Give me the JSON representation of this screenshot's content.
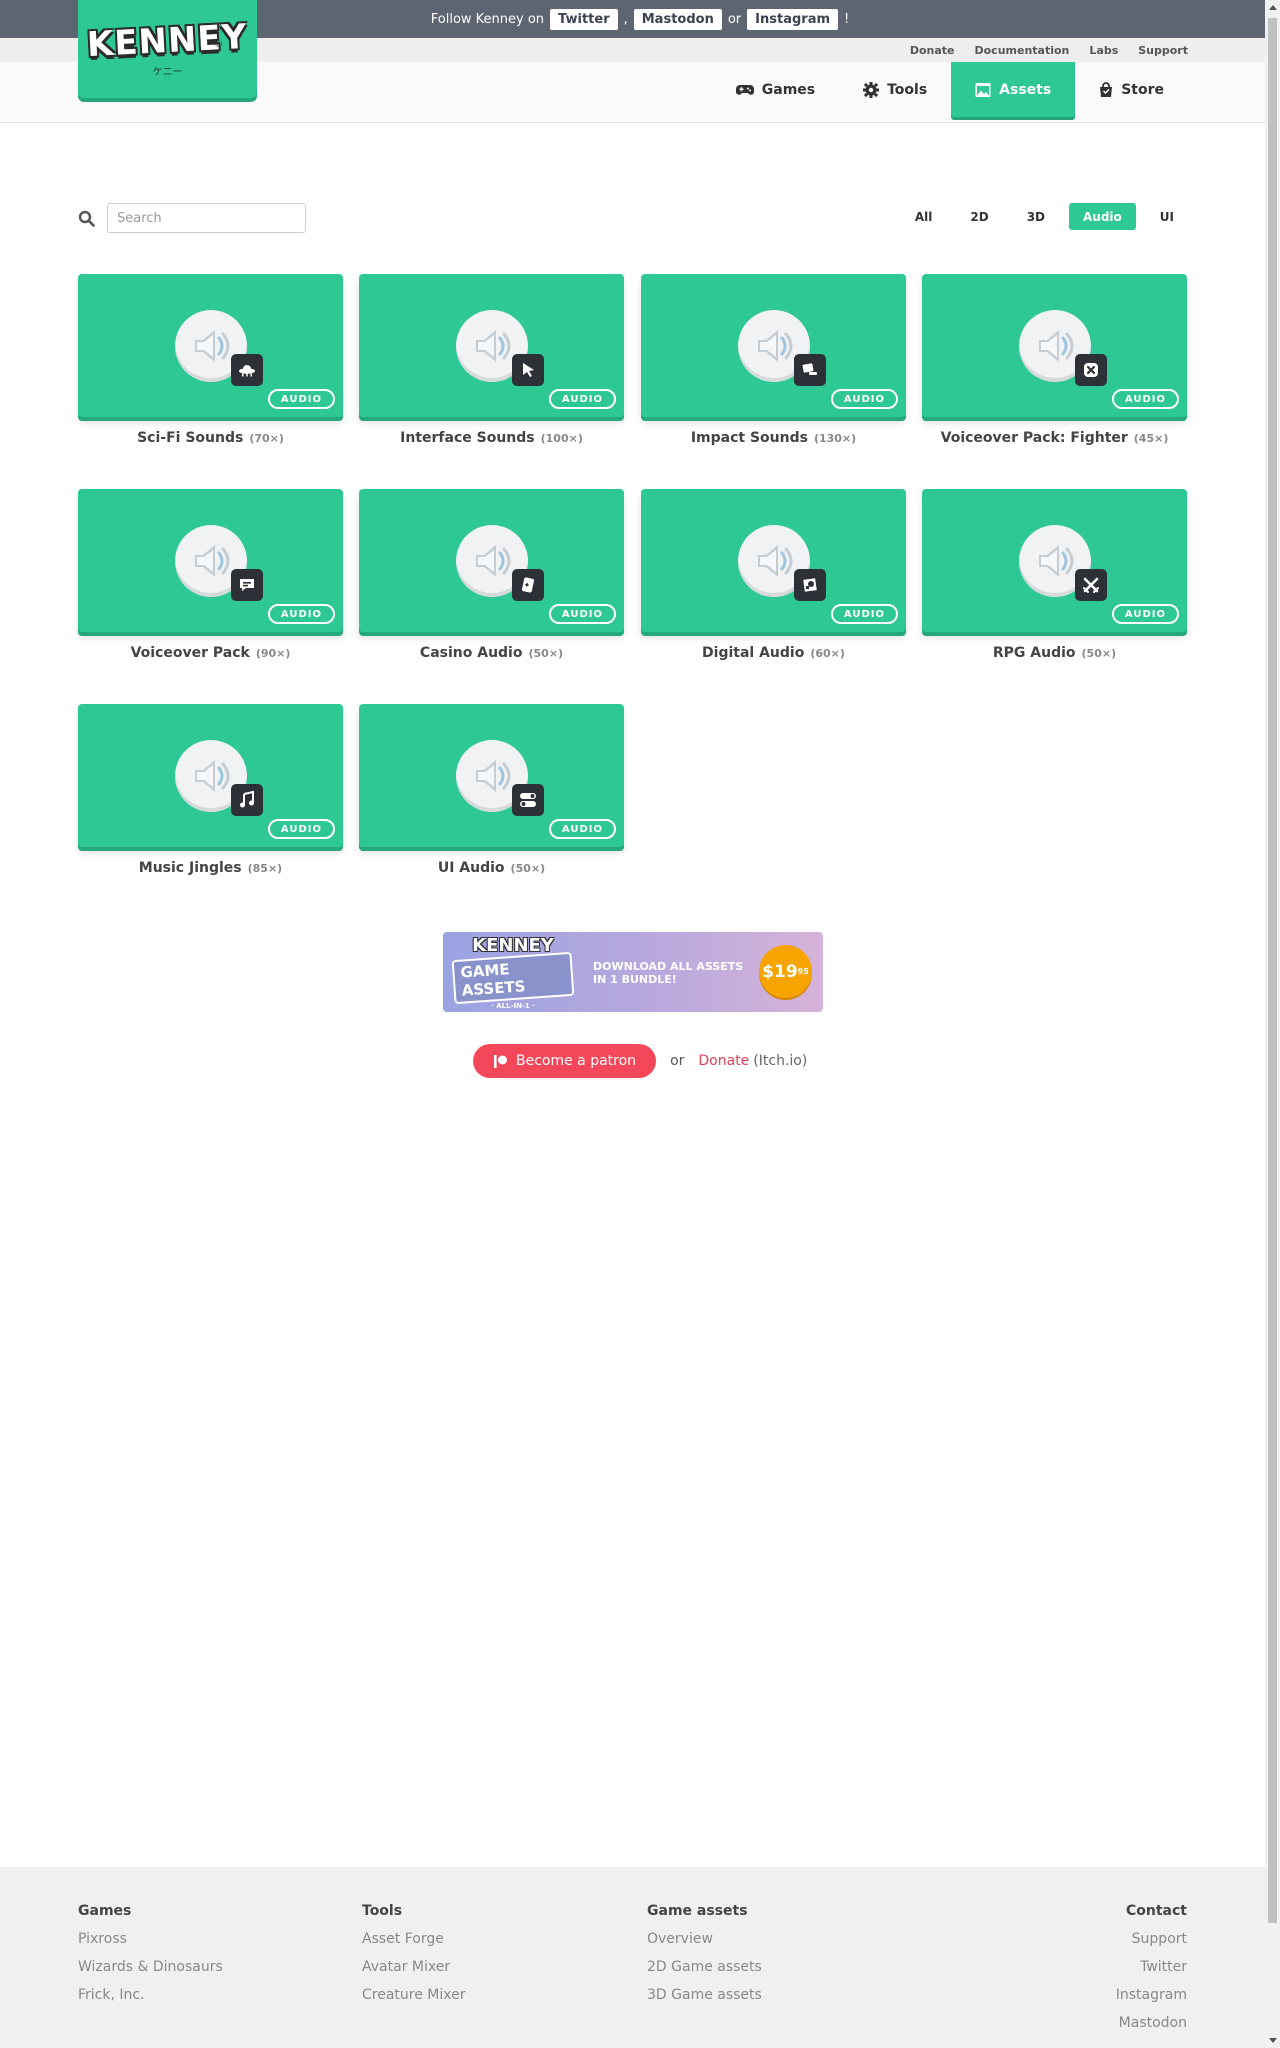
{
  "social_bar": {
    "prefix": "Follow Kenney on",
    "twitter": "Twitter",
    "comma": ",",
    "mastodon": "Mastodon",
    "or": "or",
    "instagram": "Instagram",
    "suffix": "!"
  },
  "sub_links": [
    "Donate",
    "Documentation",
    "Labs",
    "Support"
  ],
  "logo": {
    "word": "KENNEY",
    "sub": "ケニー",
    "reg": "®"
  },
  "nav": [
    {
      "label": "Games",
      "icon": "gamepad-icon"
    },
    {
      "label": "Tools",
      "icon": "gear-icon"
    },
    {
      "label": "Assets",
      "icon": "image-icon",
      "active": true
    },
    {
      "label": "Store",
      "icon": "bag-icon"
    }
  ],
  "search": {
    "placeholder": "Search",
    "value": ""
  },
  "filters": [
    {
      "label": "All"
    },
    {
      "label": "2D"
    },
    {
      "label": "3D"
    },
    {
      "label": "Audio",
      "active": true
    },
    {
      "label": "UI"
    }
  ],
  "assets": [
    {
      "title": "Sci-Fi Sounds",
      "count": "(70×)",
      "tag": "AUDIO",
      "icon": "ufo-icon"
    },
    {
      "title": "Interface Sounds",
      "count": "(100×)",
      "tag": "AUDIO",
      "icon": "cursor-icon"
    },
    {
      "title": "Impact Sounds",
      "count": "(130×)",
      "tag": "AUDIO",
      "icon": "impact-icon"
    },
    {
      "title": "Voiceover Pack: Fighter",
      "count": "(45×)",
      "tag": "AUDIO",
      "icon": "fighter-icon"
    },
    {
      "title": "Voiceover Pack",
      "count": "(90×)",
      "tag": "AUDIO",
      "icon": "speech-bubble-icon"
    },
    {
      "title": "Casino Audio",
      "count": "(50×)",
      "tag": "AUDIO",
      "icon": "cards-icon"
    },
    {
      "title": "Digital Audio",
      "count": "(60×)",
      "tag": "AUDIO",
      "icon": "digital-icon"
    },
    {
      "title": "RPG Audio",
      "count": "(50×)",
      "tag": "AUDIO",
      "icon": "crossed-swords-icon"
    },
    {
      "title": "Music Jingles",
      "count": "(85×)",
      "tag": "AUDIO",
      "icon": "music-note-icon"
    },
    {
      "title": "UI Audio",
      "count": "(50×)",
      "tag": "AUDIO",
      "icon": "toggle-icon"
    }
  ],
  "banner": {
    "logo_top": "KENNEY",
    "logo_mid": "GAME ASSETS",
    "logo_bottom": "· ALL-IN-1 ·",
    "text_line1": "DOWNLOAD ALL ASSETS",
    "text_line2": "IN 1 BUNDLE!",
    "price": "$19",
    "price_cents": "95"
  },
  "patron": {
    "button": "Become a patron",
    "or": "or",
    "donate": "Donate",
    "itch": "(Itch.io)"
  },
  "footer": {
    "columns": [
      {
        "heading": "Games",
        "links": [
          "Pixross",
          "Wizards & Dinosaurs",
          "Frick, Inc."
        ]
      },
      {
        "heading": "Tools",
        "links": [
          "Asset Forge",
          "Avatar Mixer",
          "Creature Mixer"
        ]
      },
      {
        "heading": "Game assets",
        "links": [
          "Overview",
          "2D Game assets",
          "3D Game assets"
        ]
      },
      {
        "heading": "Contact",
        "links": [
          "Support",
          "Twitter",
          "Instagram",
          "Mastodon"
        ]
      }
    ]
  },
  "colors": {
    "brand": "#2ec894",
    "topbar": "#5d6472",
    "patron": "#f5475a"
  }
}
